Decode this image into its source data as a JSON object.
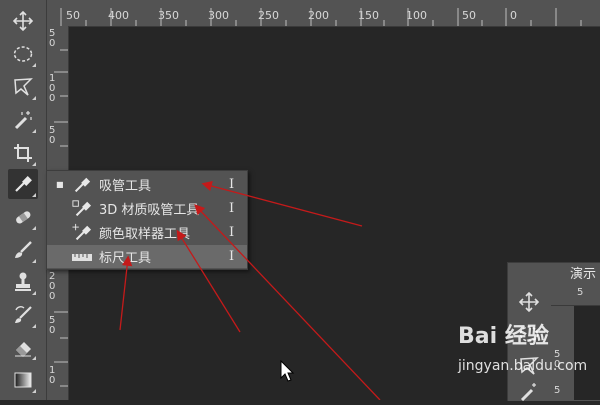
{
  "ruler": {
    "top_labels": [
      "50",
      "400",
      "350",
      "300",
      "250",
      "200",
      "150",
      "100",
      "50",
      "0"
    ],
    "left_digits": [
      [
        "5",
        "0"
      ],
      [
        "1",
        "0",
        "0"
      ],
      [
        "5",
        "0"
      ],
      [
        "2",
        "0",
        "0"
      ],
      [
        "5",
        "0"
      ],
      [
        "1",
        "0"
      ]
    ]
  },
  "toolbar": {
    "tools": [
      {
        "name": "move-tool",
        "icon": "move-icon"
      },
      {
        "name": "marquee-tool",
        "icon": "ellipse-marquee-icon"
      },
      {
        "name": "lasso-tool",
        "icon": "polygonal-lasso-icon"
      },
      {
        "name": "magic-wand-tool",
        "icon": "magic-wand-icon"
      },
      {
        "name": "crop-tool",
        "icon": "crop-icon"
      },
      {
        "name": "eyedropper-tool",
        "icon": "eyedropper-icon"
      },
      {
        "name": "healing-brush-tool",
        "icon": "bandage-icon"
      },
      {
        "name": "brush-tool",
        "icon": "brush-icon"
      },
      {
        "name": "clone-stamp-tool",
        "icon": "stamp-icon"
      },
      {
        "name": "history-brush-tool",
        "icon": "history-brush-icon"
      },
      {
        "name": "eraser-tool",
        "icon": "eraser-icon"
      },
      {
        "name": "gradient-tool",
        "icon": "gradient-icon"
      }
    ]
  },
  "flyout": {
    "items": [
      {
        "label": "吸管工具",
        "shortcut": "I",
        "icon": "eyedropper-icon",
        "selected": true
      },
      {
        "label": "3D 材质吸管工具",
        "shortcut": "I",
        "icon": "3d-material-eyedropper-icon",
        "selected": false
      },
      {
        "label": "颜色取样器工具",
        "shortcut": "I",
        "icon": "color-sampler-icon",
        "selected": false
      },
      {
        "label": "标尺工具",
        "shortcut": "I",
        "icon": "ruler-icon",
        "selected": false,
        "highlighted": true
      }
    ]
  },
  "panel2": {
    "tab_label": "演示",
    "ruler_digit": "5",
    "left_digits": [
      "5",
      "0",
      "5"
    ]
  },
  "watermark": {
    "line1": "Bai 经验",
    "line2": "jingyan.baidu.com"
  },
  "colors": {
    "panel": "#535353",
    "canvas": "#282828",
    "annotation_arrow": "#c41a1a"
  }
}
